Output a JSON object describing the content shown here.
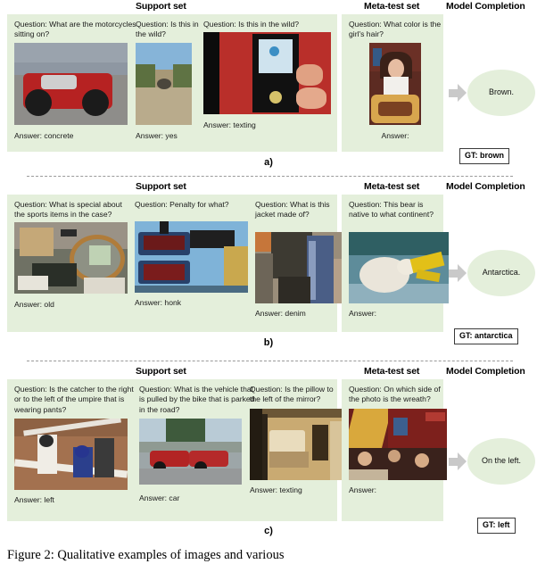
{
  "figure": {
    "caption": "Figure 2: Qualitative examples of images and various",
    "panel_bg": "#e4efdb",
    "arrow_color": "#c9c9c9"
  },
  "headers": {
    "support": "Support set",
    "metatest": "Meta-test set",
    "model": "Model Completion"
  },
  "panels": [
    {
      "id": "a",
      "label": "a)",
      "support": [
        {
          "question": "Question: What are the motorcycles sitting on?",
          "answer": "Answer: concrete"
        },
        {
          "question": "Question: Is this in the wild?",
          "answer": "Answer: yes"
        },
        {
          "question": "Question: Is this in the wild?",
          "answer": "Answer: texting"
        }
      ],
      "metatest": {
        "question": "Question: What color is the girl's hair?",
        "answer": "Answer:"
      },
      "completion": "Brown.",
      "gt": "GT: brown"
    },
    {
      "id": "b",
      "label": "b)",
      "support": [
        {
          "question": "Question: What is special about the sports items in the case?",
          "answer": "Answer: old"
        },
        {
          "question": "Question: Penalty for what?",
          "answer": "Answer: honk"
        },
        {
          "question": "Question: What is this jacket made of?",
          "answer": "Answer: denim"
        }
      ],
      "metatest": {
        "question": "Question: This bear is native to what continent?",
        "answer": "Answer:"
      },
      "completion": "Antarctica.",
      "gt": "GT: antarctica"
    },
    {
      "id": "c",
      "label": "c)",
      "support": [
        {
          "question": "Question: Is the catcher to the right or to the left of the umpire that is wearing pants?",
          "answer": "Answer: left"
        },
        {
          "question": "Question: What is the vehicle that is pulled by the bike that is parked in the road?",
          "answer": "Answer: car"
        },
        {
          "question": "Question: Is the pillow to the left of the mirror?",
          "answer": "Answer: texting"
        }
      ],
      "metatest": {
        "question": "Question: On which side of the photo is the wreath?",
        "answer": "Answer:"
      },
      "completion": "On the left.",
      "gt": "GT: left"
    }
  ]
}
